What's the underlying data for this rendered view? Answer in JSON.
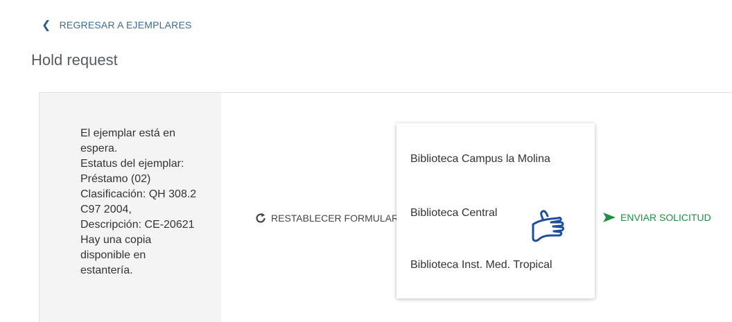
{
  "nav": {
    "back_label": "REGRESAR A EJEMPLARES"
  },
  "page": {
    "title": "Hold request"
  },
  "item_info": {
    "lines": [
      "El ejemplar está en",
      "espera.",
      "Estatus del ejemplar:",
      "Préstamo (02)",
      "Clasificación: QH 308.2",
      "C97 2004,",
      "Descripción: CE-20621",
      "Hay una copia",
      "disponible en",
      "estantería."
    ]
  },
  "actions": {
    "reset_label": "RESTABLECER FORMULARIO",
    "send_label": "ENVIAR SOLICITUD"
  },
  "pickup_dropdown": {
    "options": [
      "Biblioteca Campus la Molina",
      "Biblioteca Central",
      "Biblioteca Inst. Med. Tropical"
    ]
  },
  "colors": {
    "link": "#3d6b8f",
    "send": "#1f8f44",
    "cursor": "#1f4e9c"
  },
  "icons": {
    "back": "chevron-left-icon",
    "reset": "refresh-icon",
    "send": "send-arrow-icon",
    "cursor": "hand-pointer-icon"
  }
}
